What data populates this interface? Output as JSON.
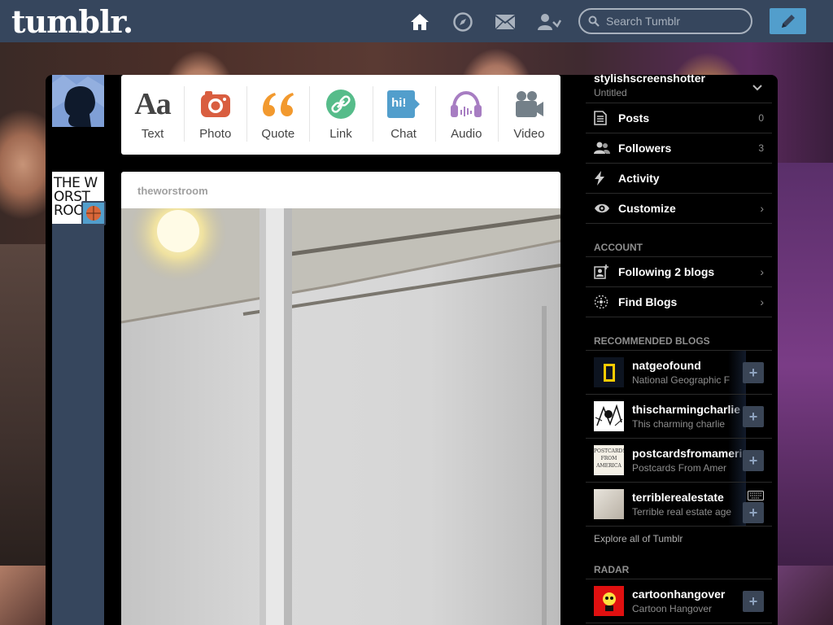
{
  "header": {
    "logo": "tumblr.",
    "search_placeholder": "Search Tumblr",
    "nav_icons": [
      "home-icon",
      "explore-compass-icon",
      "inbox-mail-icon",
      "account-person-icon"
    ],
    "compose_icon": "pencil-icon",
    "colors": {
      "bar": "#36465d",
      "compose": "#529ecc"
    }
  },
  "composer": {
    "types": [
      {
        "label": "Text",
        "icon": "text-aa-icon",
        "color": "#444444"
      },
      {
        "label": "Photo",
        "icon": "camera-icon",
        "color": "#d95e40"
      },
      {
        "label": "Quote",
        "icon": "quote-icon",
        "color": "#f2992e"
      },
      {
        "label": "Link",
        "icon": "link-icon",
        "color": "#56bc8a"
      },
      {
        "label": "Chat",
        "icon": "chat-bubble-icon",
        "color": "#529ecc"
      },
      {
        "label": "Audio",
        "icon": "headphones-icon",
        "color": "#a77dc2"
      },
      {
        "label": "Video",
        "icon": "video-camera-icon",
        "color": "#748089"
      }
    ],
    "chat_icon_text": "hi!",
    "text_icon_glyph": "Aa"
  },
  "post": {
    "blog_name": "theworstroom",
    "avatar_text": "THE WORST ROO"
  },
  "sidebar": {
    "blog": {
      "name": "stylishscreenshotter",
      "title": "Untitled"
    },
    "rows": [
      {
        "label": "Posts",
        "count": "0",
        "icon": "document-icon"
      },
      {
        "label": "Followers",
        "count": "3",
        "icon": "people-icon"
      },
      {
        "label": "Activity",
        "icon": "lightning-icon"
      },
      {
        "label": "Customize",
        "icon": "eye-icon"
      }
    ],
    "account_heading": "ACCOUNT",
    "account_rows": [
      {
        "label": "Following 2 blogs",
        "icon": "add-person-icon"
      },
      {
        "label": "Find Blogs",
        "icon": "find-dots-icon"
      }
    ],
    "recommended_heading": "RECOMMENDED BLOGS",
    "recommended": [
      {
        "name": "natgeofound",
        "desc": "National Geographic F"
      },
      {
        "name": "thischarmingcharlie",
        "desc": "This charming charlie"
      },
      {
        "name": "postcardsfromamerica",
        "desc": "Postcards From Amer",
        "thumb_text": "POSTCARDS FROM AMERICA"
      },
      {
        "name": "terriblerealestate",
        "desc": "Terrible real estate age"
      }
    ],
    "follow_glyph": "+",
    "explore": "Explore all of Tumblr",
    "radar_heading": "RADAR",
    "radar": [
      {
        "name": "cartoonhangover",
        "desc": "Cartoon Hangover"
      }
    ]
  }
}
